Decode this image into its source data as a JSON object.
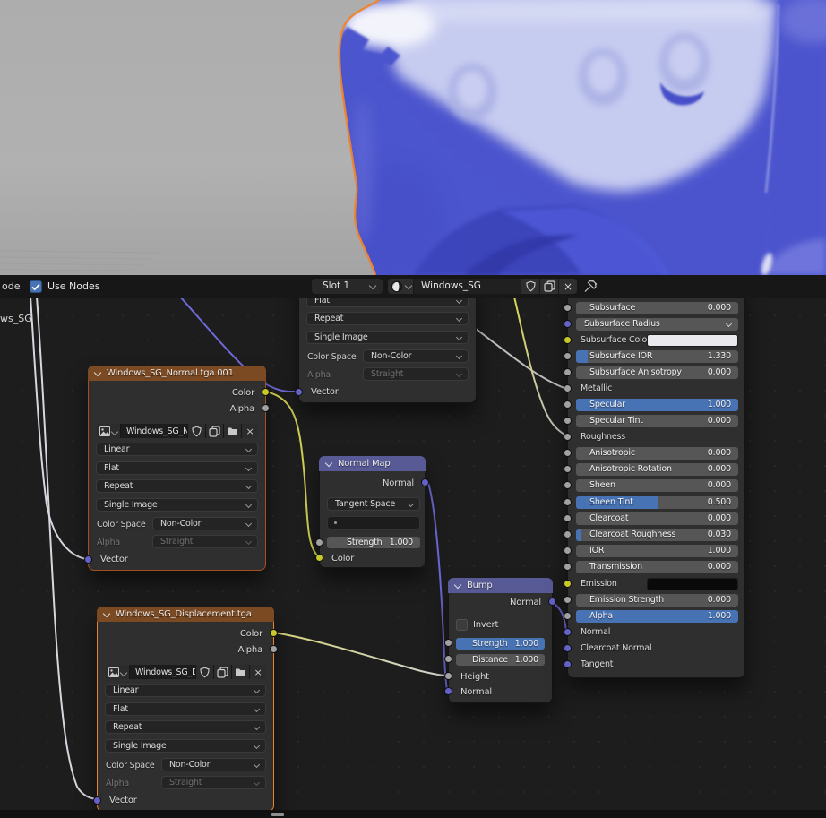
{
  "colors": {
    "accent_blue": "#4772b3",
    "selection_orange": "#e8832f",
    "tex_header": "#7b4a22",
    "vector_header": "#585a96",
    "socket_yellow": "#c7c729",
    "socket_gray": "#a1a1a1",
    "socket_vector": "#6462c9",
    "viewport_object_blue": "#4b54cd",
    "outline_orange": "#f2842b"
  },
  "editor_header": {
    "node_menu_partial": "ode",
    "use_nodes": "Use Nodes",
    "slot": "Slot 1",
    "material_name": "Windows_SG"
  },
  "canvas": {
    "offscreen_node_label": "ws_SG"
  },
  "tex_common": {
    "color_out": "Color",
    "alpha_out": "Alpha",
    "interpolation": "Linear",
    "projection": "Flat",
    "extension": "Repeat",
    "source": "Single Image",
    "color_space_label": "Color Space",
    "color_space": "Non-Color",
    "alpha_label": "Alpha",
    "alpha_mode": "Straight",
    "vector_in": "Vector"
  },
  "nodes": {
    "normal_tex": {
      "title": "Windows_SG_Normal.tga.001",
      "image_name": "Windows_SG_No..."
    },
    "disp_tex": {
      "title": "Windows_SG_Displacement.tga",
      "image_name": "Windows_SG_Dis..."
    },
    "normal_map": {
      "title": "Normal Map",
      "normal_out": "Normal",
      "space": "Tangent Space",
      "strength_label": "Strength",
      "strength": "1.000",
      "color_in": "Color"
    },
    "bump": {
      "title": "Bump",
      "normal_out": "Normal",
      "invert": "Invert",
      "strength_label": "Strength",
      "strength": "1.000",
      "distance_label": "Distance",
      "distance": "1.000",
      "height_in": "Height",
      "normal_in": "Normal"
    }
  },
  "bsdf": {
    "rows": [
      {
        "label": "Subsurface",
        "value": "0.000",
        "fill": 0
      },
      {
        "label": "Subsurface Radius"
      },
      {
        "label": "Subsurface Color",
        "swatch": "#e9e9ee"
      },
      {
        "label": "Subsurface IOR",
        "value": "1.330",
        "fill": 0.07
      },
      {
        "label": "Subsurface Anisotropy",
        "value": "0.000",
        "fill": 0
      },
      {
        "label": "Metallic"
      },
      {
        "label": "Specular",
        "value": "1.000",
        "fill": 1
      },
      {
        "label": "Specular Tint",
        "value": "0.000",
        "fill": 0
      },
      {
        "label": "Roughness"
      },
      {
        "label": "Anisotropic",
        "value": "0.000",
        "fill": 0
      },
      {
        "label": "Anisotropic Rotation",
        "value": "0.000",
        "fill": 0
      },
      {
        "label": "Sheen",
        "value": "0.000",
        "fill": 0
      },
      {
        "label": "Sheen Tint",
        "value": "0.500",
        "fill": 0.5
      },
      {
        "label": "Clearcoat",
        "value": "0.000",
        "fill": 0
      },
      {
        "label": "Clearcoat Roughness",
        "value": "0.030",
        "fill": 0.03
      },
      {
        "label": "IOR",
        "value": "1.000",
        "fill": 0
      },
      {
        "label": "Transmission",
        "value": "0.000",
        "fill": 0
      },
      {
        "label": "Emission",
        "swatch": "#0a0a0a"
      },
      {
        "label": "Emission Strength",
        "value": "0.000",
        "fill": 0
      },
      {
        "label": "Alpha",
        "value": "1.000",
        "fill": 1
      },
      {
        "label": "Normal"
      },
      {
        "label": "Clearcoat Normal"
      },
      {
        "label": "Tangent"
      }
    ]
  }
}
